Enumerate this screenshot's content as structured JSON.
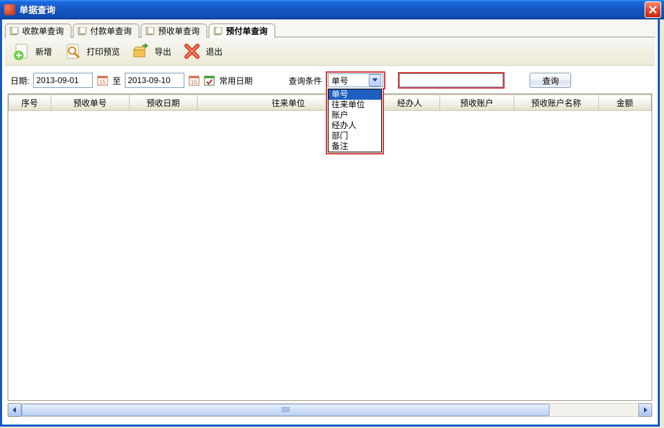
{
  "window": {
    "title": "单据查询"
  },
  "tabs": [
    {
      "label": "收款单查询"
    },
    {
      "label": "付款单查询"
    },
    {
      "label": "预收单查询"
    },
    {
      "label": "预付单查询",
      "active": true
    }
  ],
  "toolbar": {
    "new_label": "新增",
    "preview_label": "打印预览",
    "export_label": "导出",
    "exit_label": "退出"
  },
  "query": {
    "date_label": "日期:",
    "date_from": "2013-09-01",
    "date_to_label": "至",
    "date_to": "2013-09-10",
    "common_dates_label": "常用日期",
    "condition_label": "查询条件",
    "condition_selected": "单号",
    "condition_options": [
      "单号",
      "往来单位",
      "账户",
      "经办人",
      "部门",
      "备注"
    ],
    "search_value": "",
    "search_btn": "查询"
  },
  "grid": {
    "columns": [
      "序号",
      "预收单号",
      "预收日期",
      "往来单位",
      "经办人",
      "预收账户",
      "预收账户名称",
      "金额"
    ]
  }
}
